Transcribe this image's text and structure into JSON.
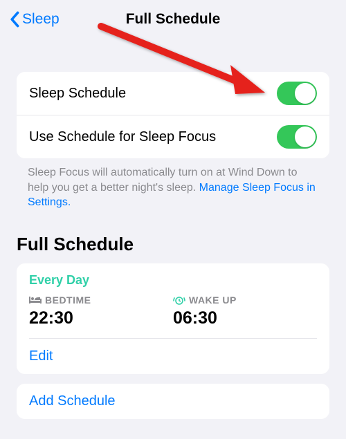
{
  "header": {
    "back_label": "Sleep",
    "title": "Full Schedule"
  },
  "toggles": {
    "sleep_schedule_label": "Sleep Schedule",
    "sleep_schedule_on": true,
    "use_schedule_focus_label": "Use Schedule for Sleep Focus",
    "use_schedule_focus_on": true
  },
  "footnote": {
    "text": "Sleep Focus will automatically turn on at Wind Down to help you get a better night's sleep.",
    "link": "Manage Sleep Focus in Settings."
  },
  "section_title": "Full Schedule",
  "schedule": {
    "days_label": "Every Day",
    "bedtime_label": "BEDTIME",
    "bedtime_value": "22:30",
    "wakeup_label": "WAKE UP",
    "wakeup_value": "06:30",
    "edit_label": "Edit"
  },
  "add_schedule_label": "Add Schedule",
  "annotation": {
    "arrow_color": "#e5221f"
  }
}
